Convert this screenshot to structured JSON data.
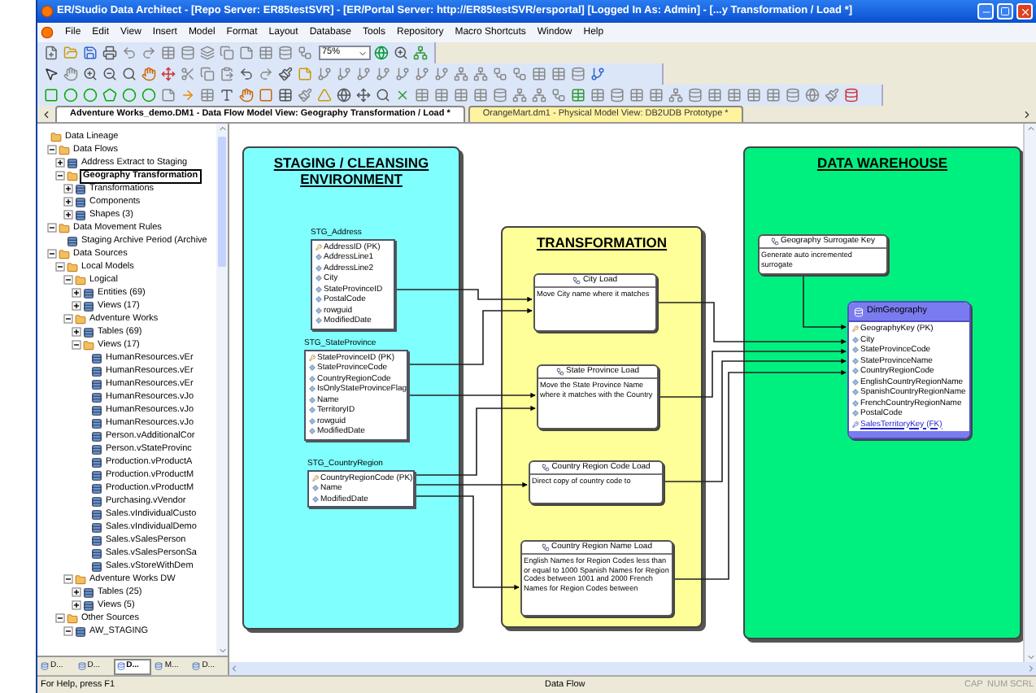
{
  "window": {
    "title": "ER/Studio Data Architect - [Repo Server: ER85testSVR] - [ER/Portal Server: http://ER85testSVR/ersportal] [Logged In As: Admin] - [...y Transformation / Load *]"
  },
  "menu": [
    "File",
    "Edit",
    "View",
    "Insert",
    "Model",
    "Format",
    "Layout",
    "Database",
    "Tools",
    "Repository",
    "Macro Shortcuts",
    "Window",
    "Help"
  ],
  "zoom": {
    "value": "75%"
  },
  "document_tabs": [
    {
      "label": "Adventure Works_demo.DM1 - Data Flow Model View: Geography Transformation / Load *",
      "selected": true,
      "color": "#ffffff"
    },
    {
      "label": "OrangeMart.dm1 - Physical Model View: DB2UDB Prototype *",
      "selected": false,
      "color": "#fff3a0"
    }
  ],
  "explorer": {
    "tree": [
      {
        "label": "Data Lineage",
        "selected": false,
        "children": [
          {
            "label": "Data Flows",
            "selected": false,
            "expanded": true,
            "children": [
              {
                "label": "Address Extract to Staging",
                "selected": false,
                "expanded": false
              },
              {
                "label": "Geography Transformation",
                "selected": true,
                "expanded": true,
                "children": [
                  {
                    "label": "Transformations",
                    "selected": false,
                    "expanded": false
                  },
                  {
                    "label": "Components",
                    "selected": false,
                    "expanded": false
                  },
                  {
                    "label": "Shapes (3)",
                    "selected": false,
                    "expanded": false
                  }
                ]
              }
            ]
          },
          {
            "label": "Data Movement Rules",
            "selected": false,
            "expanded": true,
            "children": [
              {
                "label": "Staging Archive Period (Archive",
                "selected": false
              }
            ]
          },
          {
            "label": "Data Sources",
            "selected": false,
            "expanded": true,
            "children": [
              {
                "label": "Local Models",
                "selected": false,
                "expanded": true,
                "children": [
                  {
                    "label": "Logical",
                    "selected": false,
                    "expanded": true,
                    "children": [
                      {
                        "label": "Entities (69)",
                        "selected": false,
                        "expanded": false
                      },
                      {
                        "label": "Views (17)",
                        "selected": false,
                        "expanded": false
                      }
                    ]
                  },
                  {
                    "label": "Adventure Works",
                    "selected": false,
                    "expanded": true,
                    "children": [
                      {
                        "label": "Tables (69)",
                        "selected": false,
                        "expanded": false
                      },
                      {
                        "label": "Views (17)",
                        "selected": false,
                        "expanded": true,
                        "children": [
                          {
                            "label": "HumanResources.vEr",
                            "selected": false
                          },
                          {
                            "label": "HumanResources.vEr",
                            "selected": false
                          },
                          {
                            "label": "HumanResources.vEr",
                            "selected": false
                          },
                          {
                            "label": "HumanResources.vJo",
                            "selected": false
                          },
                          {
                            "label": "HumanResources.vJo",
                            "selected": false
                          },
                          {
                            "label": "HumanResources.vJo",
                            "selected": false
                          },
                          {
                            "label": "Person.vAdditionalCor",
                            "selected": false
                          },
                          {
                            "label": "Person.vStateProvinc",
                            "selected": false
                          },
                          {
                            "label": "Production.vProductA",
                            "selected": false
                          },
                          {
                            "label": "Production.vProductM",
                            "selected": false
                          },
                          {
                            "label": "Production.vProductM",
                            "selected": false
                          },
                          {
                            "label": "Purchasing.vVendor",
                            "selected": false
                          },
                          {
                            "label": "Sales.vIndividualCusto",
                            "selected": false
                          },
                          {
                            "label": "Sales.vIndividualDemo",
                            "selected": false
                          },
                          {
                            "label": "Sales.vSalesPerson",
                            "selected": false
                          },
                          {
                            "label": "Sales.vSalesPersonSa",
                            "selected": false
                          },
                          {
                            "label": "Sales.vStoreWithDem",
                            "selected": false
                          }
                        ]
                      }
                    ]
                  },
                  {
                    "label": "Adventure Works DW",
                    "selected": false,
                    "expanded": true,
                    "children": [
                      {
                        "label": "Tables (25)",
                        "selected": false,
                        "expanded": false
                      },
                      {
                        "label": "Views (5)",
                        "selected": false,
                        "expanded": false
                      }
                    ]
                  }
                ]
              },
              {
                "label": "Other Sources",
                "selected": false,
                "expanded": true,
                "children": [
                  {
                    "label": "AW_STAGING",
                    "selected": false,
                    "expanded": true
                  }
                ]
              }
            ]
          }
        ]
      }
    ],
    "panel_tabs": [
      {
        "label": "D...",
        "selected": false
      },
      {
        "label": "D...",
        "selected": false
      },
      {
        "label": "D...",
        "selected": true
      },
      {
        "label": "M...",
        "selected": false
      },
      {
        "label": "D...",
        "selected": false
      }
    ]
  },
  "diagram": {
    "areas": [
      {
        "title": "STAGING / CLEANSING ENVIRONMENT",
        "color": "#80ffff"
      },
      {
        "title": "TRANSFORMATION",
        "color": "#ffff99"
      },
      {
        "title": "DATA WAREHOUSE",
        "color": "#00f080"
      }
    ],
    "entities": [
      {
        "name": "STG_Address",
        "kind": "staging",
        "fields": [
          {
            "name": "AddressID (PK)",
            "kind": "pk"
          },
          {
            "name": "AddressLine1",
            "kind": "attr"
          },
          {
            "name": "AddressLine2",
            "kind": "attr"
          },
          {
            "name": "City",
            "kind": "attr"
          },
          {
            "name": "StateProvinceID",
            "kind": "attr"
          },
          {
            "name": "PostalCode",
            "kind": "attr"
          },
          {
            "name": "rowguid",
            "kind": "attr"
          },
          {
            "name": "ModifiedDate",
            "kind": "attr"
          }
        ]
      },
      {
        "name": "STG_StateProvince",
        "kind": "staging",
        "fields": [
          {
            "name": "StateProvinceID (PK)",
            "kind": "pk"
          },
          {
            "name": "StateProvinceCode",
            "kind": "attr"
          },
          {
            "name": "CountryRegionCode",
            "kind": "attr"
          },
          {
            "name": "IsOnlyStateProvinceFlag",
            "kind": "attr"
          },
          {
            "name": "Name",
            "kind": "attr"
          },
          {
            "name": "TerritoryID",
            "kind": "attr"
          },
          {
            "name": "rowguid",
            "kind": "attr"
          },
          {
            "name": "ModifiedDate",
            "kind": "attr"
          }
        ]
      },
      {
        "name": "STG_CountryRegion",
        "kind": "staging",
        "fields": [
          {
            "name": "CountryRegionCode (PK)",
            "kind": "pk"
          },
          {
            "name": "Name",
            "kind": "attr"
          },
          {
            "name": "ModifiedDate",
            "kind": "attr"
          }
        ]
      },
      {
        "name": "DimGeography",
        "kind": "dimension",
        "fields": [
          {
            "name": "GeographyKey (PK)",
            "kind": "pk"
          },
          {
            "name": "City",
            "kind": "attr"
          },
          {
            "name": "StateProvinceCode",
            "kind": "attr"
          },
          {
            "name": "StateProvinceName",
            "kind": "attr"
          },
          {
            "name": "CountryRegionCode",
            "kind": "attr"
          },
          {
            "name": "EnglishCountryRegionName",
            "kind": "attr"
          },
          {
            "name": "SpanishCountryRegionName",
            "kind": "attr"
          },
          {
            "name": "FrenchCountryRegionName",
            "kind": "attr"
          },
          {
            "name": "PostalCode",
            "kind": "attr"
          },
          {
            "name": "SalesTerritoryKey (FK)",
            "kind": "fk"
          }
        ]
      }
    ],
    "transformations": [
      {
        "title": "City Load",
        "description": "Move City name where it matches"
      },
      {
        "title": "State Province Load",
        "description": "Move the State Province Name where it matches with the Country"
      },
      {
        "title": "Country Region Code Load",
        "description": "Direct copy of country code to"
      },
      {
        "title": "Country Region Name Load",
        "description": "English Names for Region Codes less than or equal to 1000 Spanish Names for Region Codes between 1001 and 2000 French Names for Region Codes between"
      },
      {
        "title": "Geography Surrogate Key",
        "description": "Generate auto incremented surrogate"
      }
    ]
  },
  "status_bar": {
    "help": "For Help, press F1",
    "mode": "Data Flow",
    "indicators": [
      "CAP",
      "NUM",
      "SCRL"
    ]
  }
}
